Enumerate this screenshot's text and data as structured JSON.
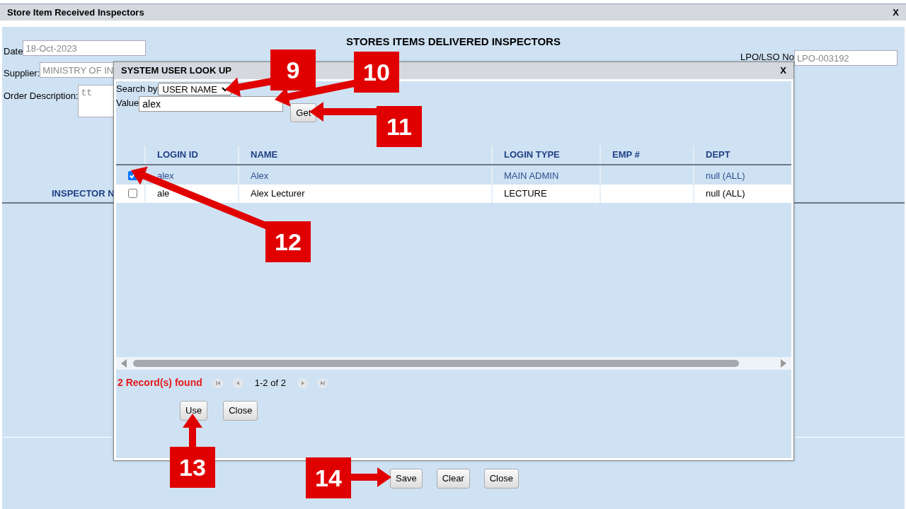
{
  "window": {
    "title": "Store Item Received Inspectors",
    "close": "X"
  },
  "form": {
    "heading": "STORES ITEMS DELIVERED INSPECTORS",
    "fields": [
      {
        "label": "Date",
        "value": "18-Oct-2023",
        "kind": "input"
      },
      {
        "label": "Supplier:",
        "value": "MINISTRY OF IN",
        "kind": "input"
      },
      {
        "label": "Order Description:",
        "value": "tt",
        "kind": "textarea"
      }
    ],
    "lpo": {
      "label": "LPO/LSO No",
      "value": "LPO-003192"
    },
    "grid_header": "INSPECTOR N",
    "buttons": [
      "Save",
      "Clear",
      "Close"
    ]
  },
  "dialog": {
    "title": "SYSTEM USER LOOK UP",
    "close": "X",
    "search_label": "Search by",
    "search_by": "USER NAME",
    "value_label": "Value",
    "value": "alex",
    "get": "Get",
    "columns": [
      "LOGIN ID",
      "NAME",
      "LOGIN TYPE",
      "EMP #",
      "DEPT"
    ],
    "rows": [
      {
        "selected": true,
        "cells": [
          "alex",
          "Alex",
          "MAIN ADMIN",
          "",
          "null (ALL)"
        ]
      },
      {
        "selected": false,
        "cells": [
          "ale",
          "Alex Lecturer",
          "LECTURE",
          "",
          "null (ALL)"
        ]
      }
    ],
    "records": "2 Record(s) found",
    "pager": "1-2 of 2",
    "buttons": [
      "Use",
      "Close"
    ]
  },
  "callouts": [
    {
      "number": "9"
    },
    {
      "number": "10"
    },
    {
      "number": "11"
    },
    {
      "number": "12"
    },
    {
      "number": "13"
    },
    {
      "number": "14"
    }
  ]
}
